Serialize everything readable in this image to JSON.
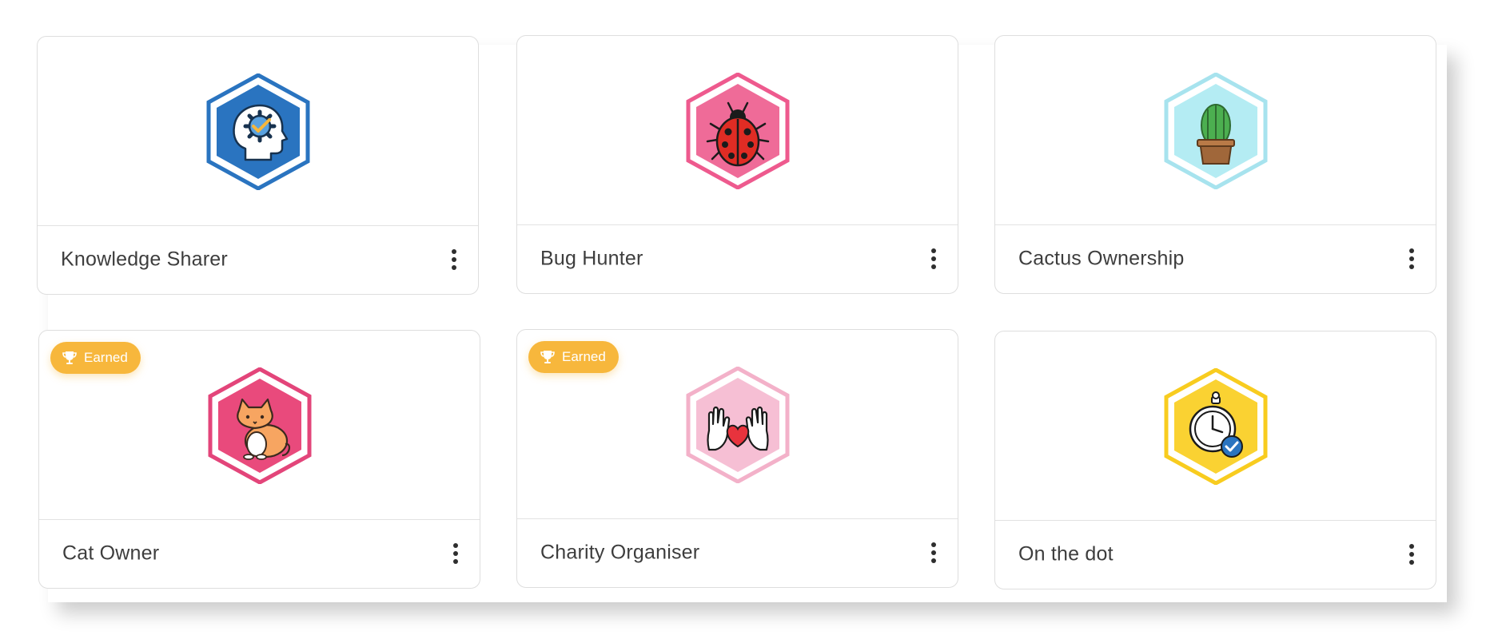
{
  "badges": [
    {
      "title": "Knowledge Sharer",
      "earned": false,
      "icon": "head-gear-check-icon",
      "hex_color": "#2a74c0",
      "ring_color": "#2a74c0"
    },
    {
      "title": "Bug Hunter",
      "earned": false,
      "icon": "ladybug-icon",
      "hex_color": "#ef6b98",
      "ring_color": "#ee5a8e"
    },
    {
      "title": "Cactus Ownership",
      "earned": false,
      "icon": "cactus-pot-icon",
      "hex_color": "#b4ecf3",
      "ring_color": "#a7e3ee"
    },
    {
      "title": "Cat Owner",
      "earned": true,
      "icon": "cat-icon",
      "hex_color": "#e94a7c",
      "ring_color": "#e3457a"
    },
    {
      "title": "Charity Organiser",
      "earned": true,
      "icon": "hands-heart-icon",
      "hex_color": "#f6bfd4",
      "ring_color": "#f3b1c9"
    },
    {
      "title": "On the dot",
      "earned": false,
      "icon": "stopwatch-check-icon",
      "hex_color": "#fad232",
      "ring_color": "#f8cc1f"
    }
  ],
  "earned_label": "Earned",
  "colors": {
    "earned_pill": "#f7b73c",
    "card_border": "#dedede",
    "title_text": "#3d3d3d"
  }
}
